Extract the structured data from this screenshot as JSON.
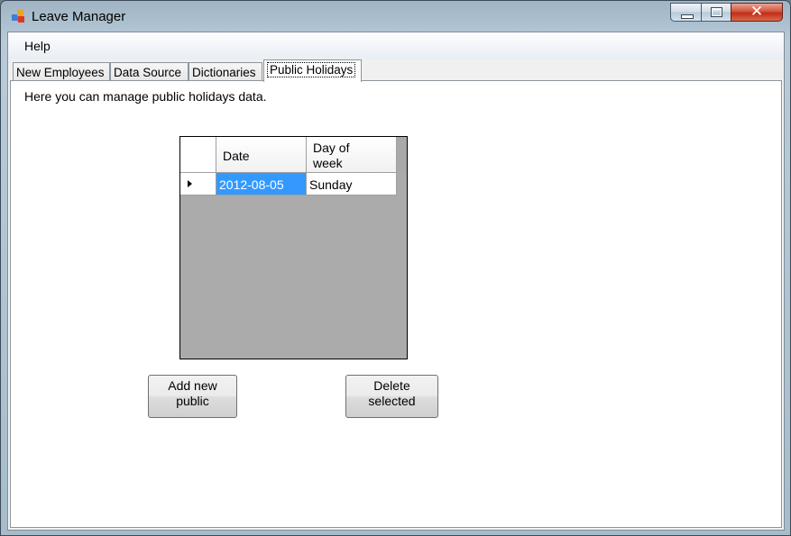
{
  "window": {
    "title": "Leave Manager",
    "close_glyph": "✕"
  },
  "menu": {
    "help_label": "Help"
  },
  "tabs": [
    {
      "label": "New Employees"
    },
    {
      "label": "Data Source"
    },
    {
      "label": "Dictionaries"
    },
    {
      "label": "Public Holidays",
      "active": true
    }
  ],
  "page": {
    "description": "Here you can manage public holidays data."
  },
  "grid": {
    "columns": [
      {
        "label_line1": "Date",
        "label_line2": ""
      },
      {
        "label_line1": "Day of",
        "label_line2": "week"
      }
    ],
    "rows": [
      {
        "date": "2012-08-05",
        "day_of_week": "Sunday",
        "selected": true
      }
    ]
  },
  "buttons": {
    "add_line1": "Add new",
    "add_line2": "public",
    "delete_line1": "Delete",
    "delete_line2": "selected"
  },
  "colors": {
    "selection": "#3399ff",
    "grid_background": "#ababab",
    "close_button": "#c02e18"
  },
  "icons": {
    "app": "app-icon",
    "row_pointer": "row-pointer-icon"
  }
}
